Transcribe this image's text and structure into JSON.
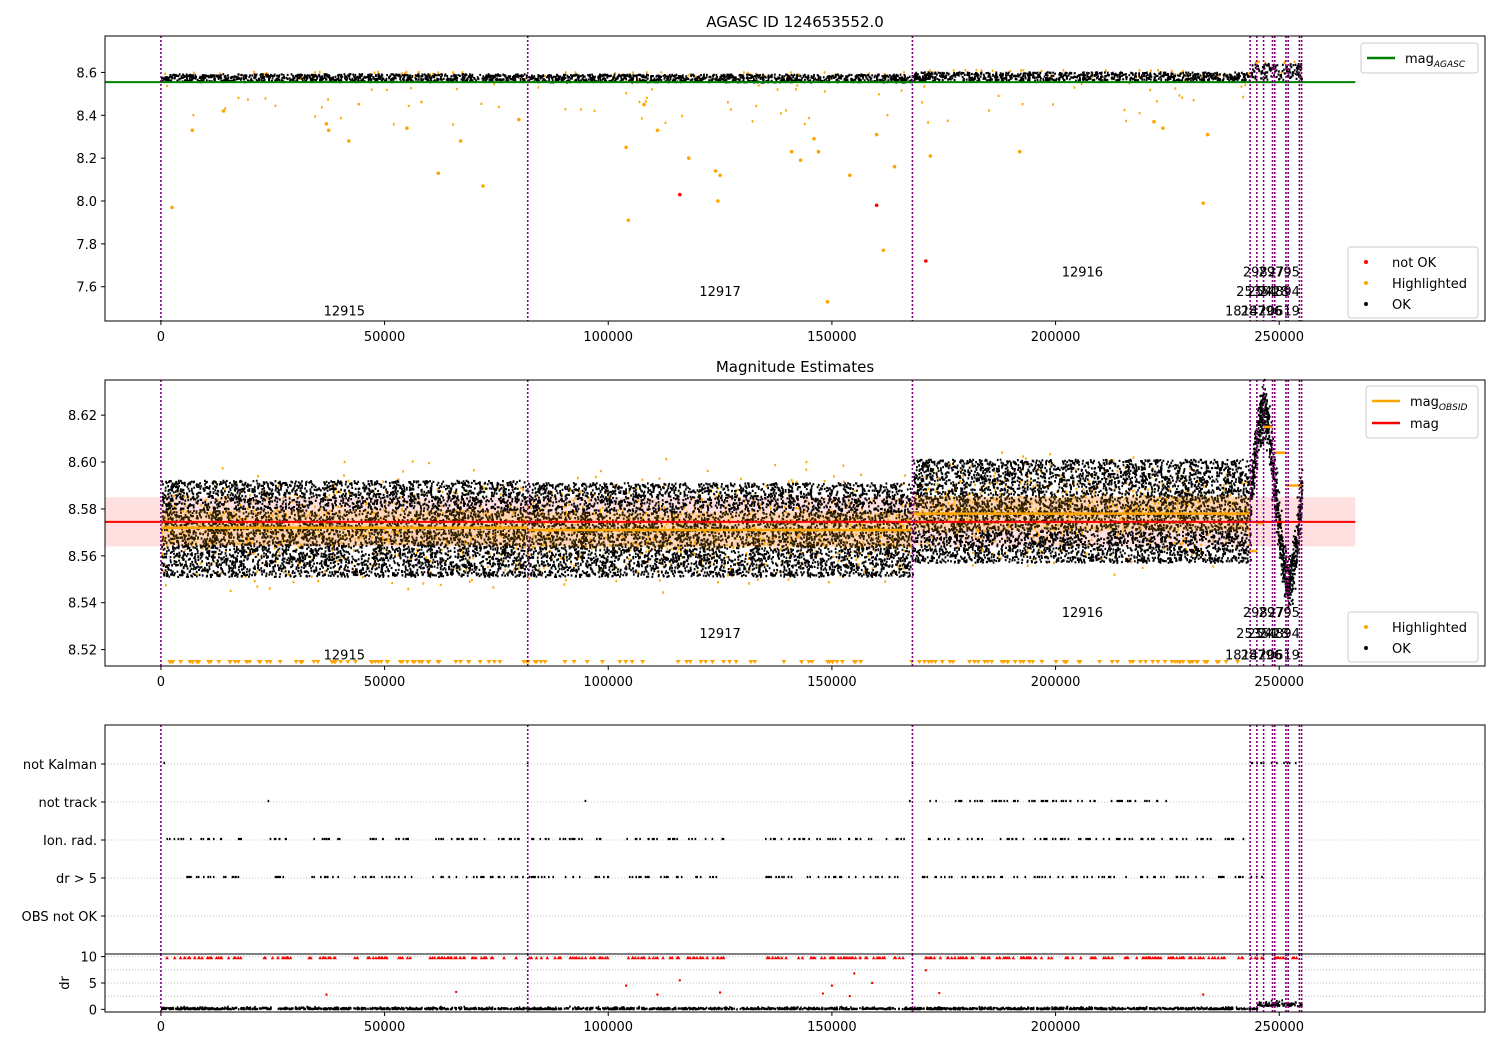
{
  "chart_data": [
    {
      "type": "scatter",
      "title": "AGASC ID 124653552.0",
      "xlabel": "",
      "ylabel": "",
      "xlim": [
        -12500,
        296000
      ],
      "ylim": [
        7.44,
        8.77
      ],
      "xticks": [
        0,
        50000,
        100000,
        150000,
        200000,
        250000
      ],
      "yticks": [
        7.6,
        7.8,
        8.0,
        8.2,
        8.4,
        8.6
      ],
      "ytick_labels": [
        "7.6",
        "7.8",
        "8.0",
        "8.2",
        "8.4",
        "8.6"
      ],
      "grid": false,
      "legend_position": "upper right / lower right",
      "line_legend": [
        {
          "label": "mag",
          "sub": "AGASC",
          "color": "#008000"
        }
      ],
      "point_legend": [
        {
          "label": "not OK",
          "color": "#ff0000"
        },
        {
          "label": "Highlighted",
          "color": "#ffa500"
        },
        {
          "label": "OK",
          "color": "#000000"
        }
      ],
      "mag_agasc": 8.555,
      "mag_agasc_xrange": [
        -12500,
        267000
      ],
      "observation_boundaries": [
        0,
        82000,
        168000,
        243500,
        245000,
        246500,
        248500,
        249000,
        251500,
        252000,
        254500,
        255000
      ],
      "obsid_labels": [
        {
          "text": "12915",
          "x": 41000,
          "y": 7.49
        },
        {
          "text": "12917",
          "x": 125000,
          "y": 7.58
        },
        {
          "text": "12916",
          "x": 206000,
          "y": 7.67
        },
        {
          "text": "29827",
          "x": 246500,
          "y": 7.67
        },
        {
          "text": "29795",
          "x": 250000,
          "y": 7.67
        },
        {
          "text": "25354",
          "x": 245000,
          "y": 7.58
        },
        {
          "text": "24894",
          "x": 250000,
          "y": 7.58
        },
        {
          "text": "25428",
          "x": 247500,
          "y": 7.58
        },
        {
          "text": "18142",
          "x": 242500,
          "y": 7.49
        },
        {
          "text": "28796",
          "x": 246000,
          "y": 7.49
        },
        {
          "text": "20619",
          "x": 250000,
          "y": 7.49
        }
      ],
      "segments": [
        {
          "x0": 0,
          "x1": 82000,
          "band": [
            8.555,
            8.592
          ]
        },
        {
          "x0": 82000,
          "x1": 168000,
          "band": [
            8.553,
            8.59
          ]
        },
        {
          "x0": 168000,
          "x1": 243500,
          "band": [
            8.56,
            8.6
          ]
        },
        {
          "x0": 243500,
          "x1": 255000,
          "band": [
            8.565,
            8.64
          ]
        }
      ],
      "highlighted_outliers": [
        [
          2500,
          7.97
        ],
        [
          7000,
          8.33
        ],
        [
          14000,
          8.42
        ],
        [
          37000,
          8.36
        ],
        [
          37500,
          8.33
        ],
        [
          42000,
          8.28
        ],
        [
          55000,
          8.34
        ],
        [
          62000,
          8.13
        ],
        [
          67000,
          8.28
        ],
        [
          72000,
          8.07
        ],
        [
          80000,
          8.38
        ],
        [
          104000,
          8.25
        ],
        [
          104500,
          7.91
        ],
        [
          108000,
          8.45
        ],
        [
          111000,
          8.33
        ],
        [
          118000,
          8.2
        ],
        [
          124000,
          8.14
        ],
        [
          124500,
          8.0
        ],
        [
          125000,
          8.12
        ],
        [
          141000,
          8.23
        ],
        [
          143000,
          8.19
        ],
        [
          146000,
          8.29
        ],
        [
          147000,
          8.23
        ],
        [
          149000,
          7.53
        ],
        [
          154000,
          8.12
        ],
        [
          160000,
          8.31
        ],
        [
          161500,
          7.77
        ],
        [
          164000,
          8.16
        ],
        [
          172000,
          8.21
        ],
        [
          192000,
          8.23
        ],
        [
          222000,
          8.37
        ],
        [
          224000,
          8.34
        ],
        [
          233000,
          7.99
        ],
        [
          234000,
          8.31
        ]
      ],
      "not_ok_points": [
        [
          116000,
          8.03
        ],
        [
          160000,
          7.98
        ],
        [
          171000,
          7.72
        ]
      ]
    },
    {
      "type": "scatter",
      "title": "Magnitude Estimates",
      "xlabel": "",
      "ylabel": "",
      "xlim": [
        -12500,
        296000
      ],
      "ylim": [
        8.513,
        8.635
      ],
      "xticks": [
        0,
        50000,
        100000,
        150000,
        200000,
        250000
      ],
      "yticks": [
        8.52,
        8.54,
        8.56,
        8.58,
        8.6,
        8.62
      ],
      "ytick_labels": [
        "8.52",
        "8.54",
        "8.56",
        "8.58",
        "8.60",
        "8.62"
      ],
      "grid": false,
      "legend_position": "upper right / lower right",
      "line_legend": [
        {
          "label": "mag",
          "sub": "OBSID",
          "color": "#ffa500"
        },
        {
          "label": "mag",
          "sub": "",
          "color": "#ff0000"
        }
      ],
      "point_legend": [
        {
          "label": "Highlighted",
          "color": "#ffa500"
        },
        {
          "label": "OK",
          "color": "#000000"
        }
      ],
      "mag": 8.5745,
      "mag_band": [
        8.564,
        8.585
      ],
      "mag_xrange": [
        -12500,
        267000
      ],
      "observation_boundaries": [
        0,
        82000,
        168000,
        243500,
        245000,
        246500,
        248500,
        249000,
        251500,
        252000,
        254500,
        255000
      ],
      "obsid_labels": [
        {
          "text": "12915",
          "x": 41000,
          "y": 8.518
        },
        {
          "text": "12917",
          "x": 125000,
          "y": 8.527
        },
        {
          "text": "12916",
          "x": 206000,
          "y": 8.536
        },
        {
          "text": "29827",
          "x": 246500,
          "y": 8.536
        },
        {
          "text": "29795",
          "x": 250000,
          "y": 8.536
        },
        {
          "text": "25354",
          "x": 245000,
          "y": 8.527
        },
        {
          "text": "24894",
          "x": 250000,
          "y": 8.527
        },
        {
          "text": "25428",
          "x": 247500,
          "y": 8.527
        },
        {
          "text": "18142",
          "x": 242500,
          "y": 8.518
        },
        {
          "text": "28796",
          "x": 246000,
          "y": 8.518
        },
        {
          "text": "20619",
          "x": 250000,
          "y": 8.518
        }
      ],
      "segments": [
        {
          "x0": 0,
          "x1": 82000,
          "mag_obsid": 8.572,
          "band": [
            8.551,
            8.592
          ]
        },
        {
          "x0": 82000,
          "x1": 168000,
          "mag_obsid": 8.571,
          "band": [
            8.551,
            8.591
          ]
        },
        {
          "x0": 168000,
          "x1": 243500,
          "mag_obsid": 8.578,
          "band": [
            8.557,
            8.601
          ]
        }
      ],
      "late_segments": [
        {
          "x0": 243500,
          "x1": 245000,
          "mag_obsid": 8.562
        },
        {
          "x0": 245000,
          "x1": 246500,
          "mag_obsid": 8.574
        },
        {
          "x0": 246500,
          "x1": 248500,
          "mag_obsid": 8.615
        },
        {
          "x0": 248500,
          "x1": 251500,
          "mag_obsid": 8.604
        },
        {
          "x0": 251500,
          "x1": 255000,
          "mag_obsid": 8.59
        }
      ]
    },
    {
      "type": "scatter",
      "title": "",
      "xlabel": "",
      "ylabel": "",
      "xlim": [
        -12500,
        296000
      ],
      "xticks": [
        0,
        50000,
        100000,
        150000,
        200000,
        250000
      ],
      "categories": [
        "not Kalman",
        "not track",
        "Ion. rad.",
        "dr > 5",
        "OBS not OK"
      ],
      "grid": true,
      "observation_boundaries": [
        0,
        82000,
        168000,
        243500,
        245000,
        246500,
        248500,
        249000,
        251500,
        252000,
        254500,
        255000
      ],
      "flag_ranges": {
        "not Kalman": [
          [
            0,
            600
          ],
          [
            81800,
            82400
          ],
          [
            167700,
            168400
          ],
          [
            243500,
            255000
          ]
        ],
        "not track": [
          [
            23000,
            24000
          ],
          [
            94000,
            95000
          ],
          [
            166000,
            168000
          ],
          [
            170000,
            225000
          ]
        ],
        "Ion. rad.": [
          [
            1000,
            18000
          ],
          [
            23000,
            30000
          ],
          [
            33000,
            40000
          ],
          [
            43000,
            56000
          ],
          [
            60000,
            81000
          ],
          [
            82000,
            100000
          ],
          [
            104000,
            126000
          ],
          [
            135000,
            166000
          ],
          [
            170000,
            242000
          ]
        ],
        "dr > 5": [
          [
            1000,
            18000
          ],
          [
            23000,
            30000
          ],
          [
            33000,
            40000
          ],
          [
            43000,
            56000
          ],
          [
            60000,
            81000
          ],
          [
            82000,
            100000
          ],
          [
            104000,
            126000
          ],
          [
            135000,
            166000
          ],
          [
            170000,
            242000
          ],
          [
            243500,
            246000
          ]
        ],
        "OBS not OK": []
      }
    },
    {
      "type": "scatter",
      "title": "",
      "xlabel": "",
      "ylabel": "dr",
      "xlim": [
        -12500,
        296000
      ],
      "ylim": [
        -0.5,
        10.5
      ],
      "xticks": [
        0,
        50000,
        100000,
        150000,
        200000,
        250000
      ],
      "xtick_labels": [
        "0",
        "50000",
        "100000",
        "150000",
        "200000",
        "250000"
      ],
      "yticks": [
        0,
        5,
        10
      ],
      "ytick_labels": [
        "0",
        "5",
        "10"
      ],
      "grid": true,
      "observation_boundaries": [
        0,
        82000,
        168000,
        243500,
        245000,
        246500,
        248500,
        249000,
        251500,
        252000,
        254500,
        255000
      ],
      "clipped_ranges": [
        [
          1000,
          18000
        ],
        [
          23000,
          30000
        ],
        [
          33000,
          40000
        ],
        [
          43000,
          56000
        ],
        [
          60000,
          81000
        ],
        [
          82000,
          100000
        ],
        [
          104000,
          126000
        ],
        [
          135000,
          166000
        ],
        [
          170000,
          242000
        ],
        [
          243500,
          255000
        ]
      ],
      "mid_points": [
        [
          37000,
          2.8
        ],
        [
          66000,
          3.3
        ],
        [
          104000,
          4.5
        ],
        [
          111000,
          2.8
        ],
        [
          116000,
          5.5
        ],
        [
          125000,
          3.2
        ],
        [
          148000,
          3.0
        ],
        [
          150000,
          4.5
        ],
        [
          154000,
          2.5
        ],
        [
          155000,
          6.8
        ],
        [
          159000,
          5.0
        ],
        [
          171000,
          7.4
        ],
        [
          174000,
          3.1
        ],
        [
          233000,
          2.8
        ]
      ]
    }
  ]
}
